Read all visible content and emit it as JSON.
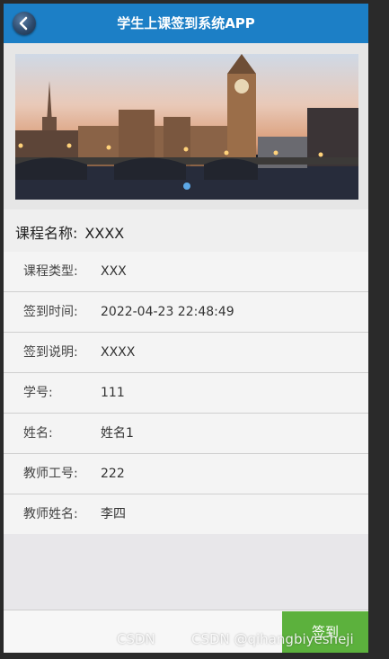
{
  "header": {
    "title": "学生上课签到系统APP",
    "back_icon": "back-arrow-icon"
  },
  "course": {
    "label": "课程名称:",
    "value": "XXXX"
  },
  "info_rows": [
    {
      "label": "课程类型:",
      "value": "XXX"
    },
    {
      "label": "签到时间:",
      "value": "2022-04-23 22:48:49"
    },
    {
      "label": "签到说明:",
      "value": "XXXX"
    },
    {
      "label": "学号:",
      "value": "111"
    },
    {
      "label": "姓名:",
      "value": "姓名1"
    },
    {
      "label": "教师工号:",
      "value": "222"
    },
    {
      "label": "教师姓名:",
      "value": "李四"
    }
  ],
  "footer": {
    "signin_label": "签到"
  },
  "watermark": {
    "left": "CSDN",
    "right": "CSDN @qihangbiyesheji"
  },
  "colors": {
    "header": "#1c7fc6",
    "signin": "#5cb13d",
    "carousel_dot": "#5da9e8"
  }
}
